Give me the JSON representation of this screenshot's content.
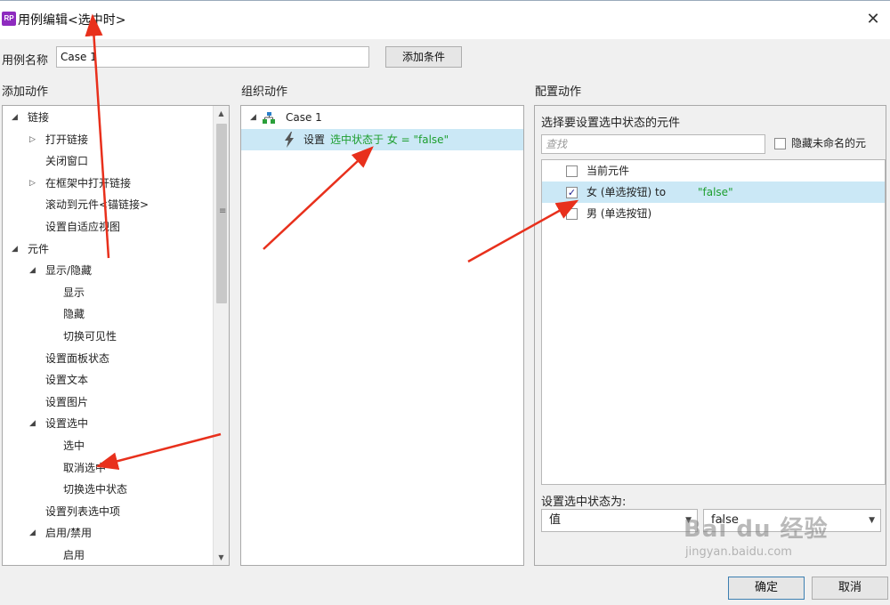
{
  "window": {
    "icon_text": "RP",
    "title": "用例编辑<选中时>",
    "close": "✕"
  },
  "case_name": {
    "label": "用例名称",
    "value": "Case 1",
    "add_condition": "添加条件"
  },
  "add_actions": {
    "heading": "添加动作",
    "items": [
      {
        "label": "链接",
        "level": 0,
        "tri": "◢"
      },
      {
        "label": "打开链接",
        "level": 1,
        "tri": "▷"
      },
      {
        "label": "关闭窗口",
        "level": 1,
        "tri": ""
      },
      {
        "label": "在框架中打开链接",
        "level": 1,
        "tri": "▷"
      },
      {
        "label": "滚动到元件<锚链接>",
        "level": 1,
        "tri": ""
      },
      {
        "label": "设置自适应视图",
        "level": 1,
        "tri": ""
      },
      {
        "label": "元件",
        "level": 0,
        "tri": "◢"
      },
      {
        "label": "显示/隐藏",
        "level": 1,
        "tri": "◢"
      },
      {
        "label": "显示",
        "level": 2,
        "tri": ""
      },
      {
        "label": "隐藏",
        "level": 2,
        "tri": ""
      },
      {
        "label": "切换可见性",
        "level": 2,
        "tri": ""
      },
      {
        "label": "设置面板状态",
        "level": 1,
        "tri": ""
      },
      {
        "label": "设置文本",
        "level": 1,
        "tri": ""
      },
      {
        "label": "设置图片",
        "level": 1,
        "tri": ""
      },
      {
        "label": "设置选中",
        "level": 1,
        "tri": "◢"
      },
      {
        "label": "选中",
        "level": 2,
        "tri": ""
      },
      {
        "label": "取消选中",
        "level": 2,
        "tri": ""
      },
      {
        "label": "切换选中状态",
        "level": 2,
        "tri": ""
      },
      {
        "label": "设置列表选中项",
        "level": 1,
        "tri": ""
      },
      {
        "label": "启用/禁用",
        "level": 1,
        "tri": "◢"
      },
      {
        "label": "启用",
        "level": 2,
        "tri": ""
      }
    ],
    "scroll_up": "▲",
    "scroll_down": "▼",
    "grip": "≡"
  },
  "organize": {
    "heading": "组织动作",
    "case_tri": "◢",
    "case_label": "Case 1",
    "action_prefix": "设置",
    "action_detail": "选中状态于 女 = \"false\""
  },
  "configure": {
    "heading": "配置动作",
    "subheading": "选择要设置选中状态的元件",
    "search_placeholder": "查找",
    "hide_unnamed": "隐藏未命名的元",
    "widgets": [
      {
        "label": "当前元件",
        "suffix": "",
        "checked": false
      },
      {
        "label": "女 (单选按钮) to ",
        "suffix": "\"false\"",
        "checked": true
      },
      {
        "label": "男 (单选按钮)",
        "suffix": "",
        "checked": false
      }
    ],
    "set_state_label": "设置选中状态为:",
    "value_type": "值",
    "value": "false",
    "check_mark": "✓"
  },
  "footer": {
    "ok": "确定",
    "cancel": "取消"
  },
  "watermark": {
    "brand": "Bai du 经验",
    "url": "jingyan.baidu.com"
  },
  "colors": {
    "selection": "#cbe8f6",
    "arrow": "#e8301c",
    "green_text": "#1d9e2e",
    "brand_icon": "#8e2bbf"
  }
}
